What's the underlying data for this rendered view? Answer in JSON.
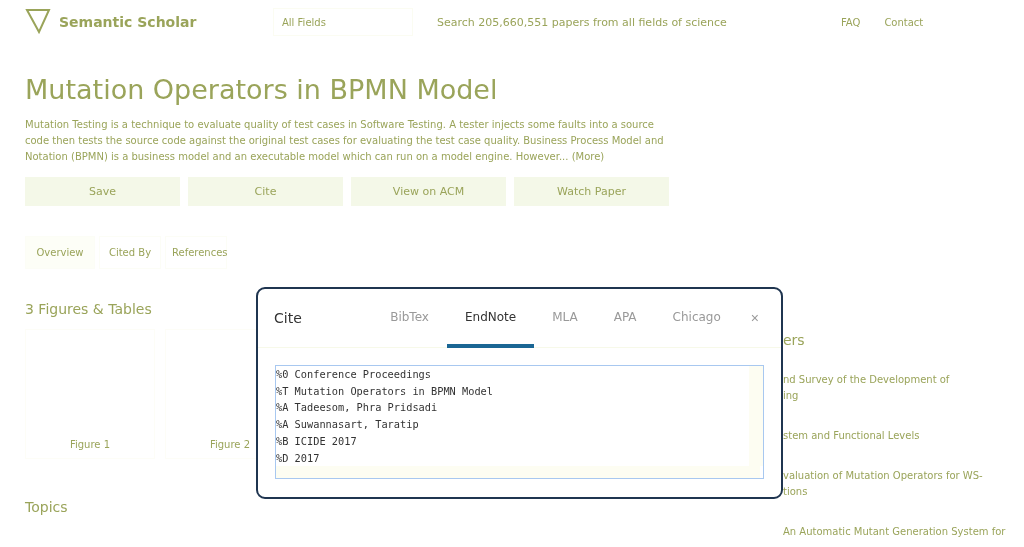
{
  "header": {
    "logo": "Semantic Scholar",
    "field_select": "All Fields",
    "search_placeholder": "Search 205,660,551 papers from all fields of science",
    "links": [
      "FAQ",
      "Contact"
    ]
  },
  "paper": {
    "title": "Mutation Operators in BPMN Model",
    "abstract": "Mutation Testing is a technique to evaluate quality of test cases in Software Testing. A tester injects some faults into a source code then tests the source code against the original test cases for evaluating the test case quality. Business Process Model and Notation (BPMN) is a business model and an executable model which can run on a model engine. However...",
    "more": "(More)"
  },
  "actions": [
    "Save",
    "Cite",
    "View on ACM",
    "Watch Paper"
  ],
  "tabs": [
    {
      "label": "Overview",
      "selected": true
    },
    {
      "label": "Cited By",
      "selected": false
    },
    {
      "label": "References",
      "selected": false
    }
  ],
  "figures": {
    "heading": "3 Figures & Tables",
    "items": [
      "Figure 1",
      "Figure 2"
    ]
  },
  "topics_heading": "Topics",
  "side": {
    "heading": "ers",
    "items": [
      "nd Survey of the Development of\ning",
      "stem and Functional Levels",
      "valuation of Mutation Operators for WS-\ntions",
      "An Automatic Mutant Generation System for"
    ]
  },
  "modal": {
    "title": "Cite",
    "tabs": [
      {
        "label": "BibTex",
        "selected": false
      },
      {
        "label": "EndNote",
        "selected": true
      },
      {
        "label": "MLA",
        "selected": false
      },
      {
        "label": "APA",
        "selected": false
      },
      {
        "label": "Chicago",
        "selected": false
      }
    ],
    "close": "×",
    "citation_lines": [
      "%0 Conference Proceedings",
      "%T Mutation Operators in BPMN Model",
      "%A Tadeesom, Phra Pridsadi",
      "%A Suwannasart, Taratip",
      "%B ICIDE 2017",
      "%D 2017"
    ]
  }
}
